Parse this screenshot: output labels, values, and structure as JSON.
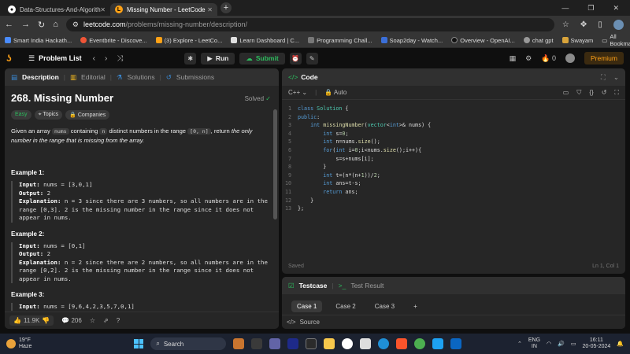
{
  "browser": {
    "tabs": [
      {
        "title": "Data-Structures-And-Algorith",
        "active": false
      },
      {
        "title": "Missing Number - LeetCode",
        "active": true
      }
    ],
    "url_domain": "leetcode.com",
    "url_path": "/problems/missing-number/description/",
    "bookmarks": [
      "Smart India Hackath...",
      "Eventbrite - Discove...",
      "(3) Explore - LeetCo...",
      "Learn Dashboard | C...",
      "Programming Chall...",
      "Soap2day - Watch...",
      "Overview - OpenAI...",
      "chat gpt",
      "Swayam"
    ],
    "all_bookmarks": "All Bookmarks"
  },
  "header": {
    "problem_list": "Problem List",
    "run": "Run",
    "submit": "Submit",
    "streak": "0",
    "premium": "Premium"
  },
  "desc_tabs": [
    "Description",
    "Editorial",
    "Solutions",
    "Submissions"
  ],
  "problem": {
    "title": "268. Missing Number",
    "status": "Solved",
    "difficulty": "Easy",
    "topics": "Topics",
    "companies": "Companies",
    "st1": "Given an array",
    "st_nums": "nums",
    "st2": "containing",
    "st_n": "n",
    "st3": "distinct numbers in the range",
    "st_range": "[0, n]",
    "st4": ", return",
    "st_em": "the only number in the range that is missing from the array.",
    "examples": [
      {
        "title": "Example 1:",
        "input": "nums = [3,0,1]",
        "output": "2",
        "expl1": "n = 3 since there are 3 numbers, so all numbers are in the",
        "expl2": "range [0,3]. 2 is the missing number in the range since it does not",
        "expl3": "appear in nums."
      },
      {
        "title": "Example 2:",
        "input": "nums = [0,1]",
        "output": "2",
        "expl1": "n = 2 since there are 2 numbers, so all numbers are in the",
        "expl2": "range [0,2]. 2 is the missing number in the range since it does not",
        "expl3": "appear in nums."
      },
      {
        "title": "Example 3:",
        "input": "nums = [9,6,4,2,3,5,7,0,1]"
      }
    ],
    "labels": {
      "input": "Input:",
      "output": "Output:",
      "explanation": "Explanation:"
    }
  },
  "footer": {
    "likes": "11.9K",
    "comments": "206"
  },
  "code": {
    "tab": "Code",
    "language": "C++",
    "mode": "Auto",
    "saved": "Saved",
    "cursor": "Ln 1, Col 1"
  },
  "testcase": {
    "tab1": "Testcase",
    "tab2": "Test Result",
    "cases": [
      "Case 1",
      "Case 2",
      "Case 3"
    ],
    "source": "Source"
  },
  "taskbar": {
    "temp": "19°F",
    "weather": "Haze",
    "search": "Search",
    "lang1": "ENG",
    "lang2": "IN",
    "time": "16:11",
    "date": "20-05-2024"
  }
}
